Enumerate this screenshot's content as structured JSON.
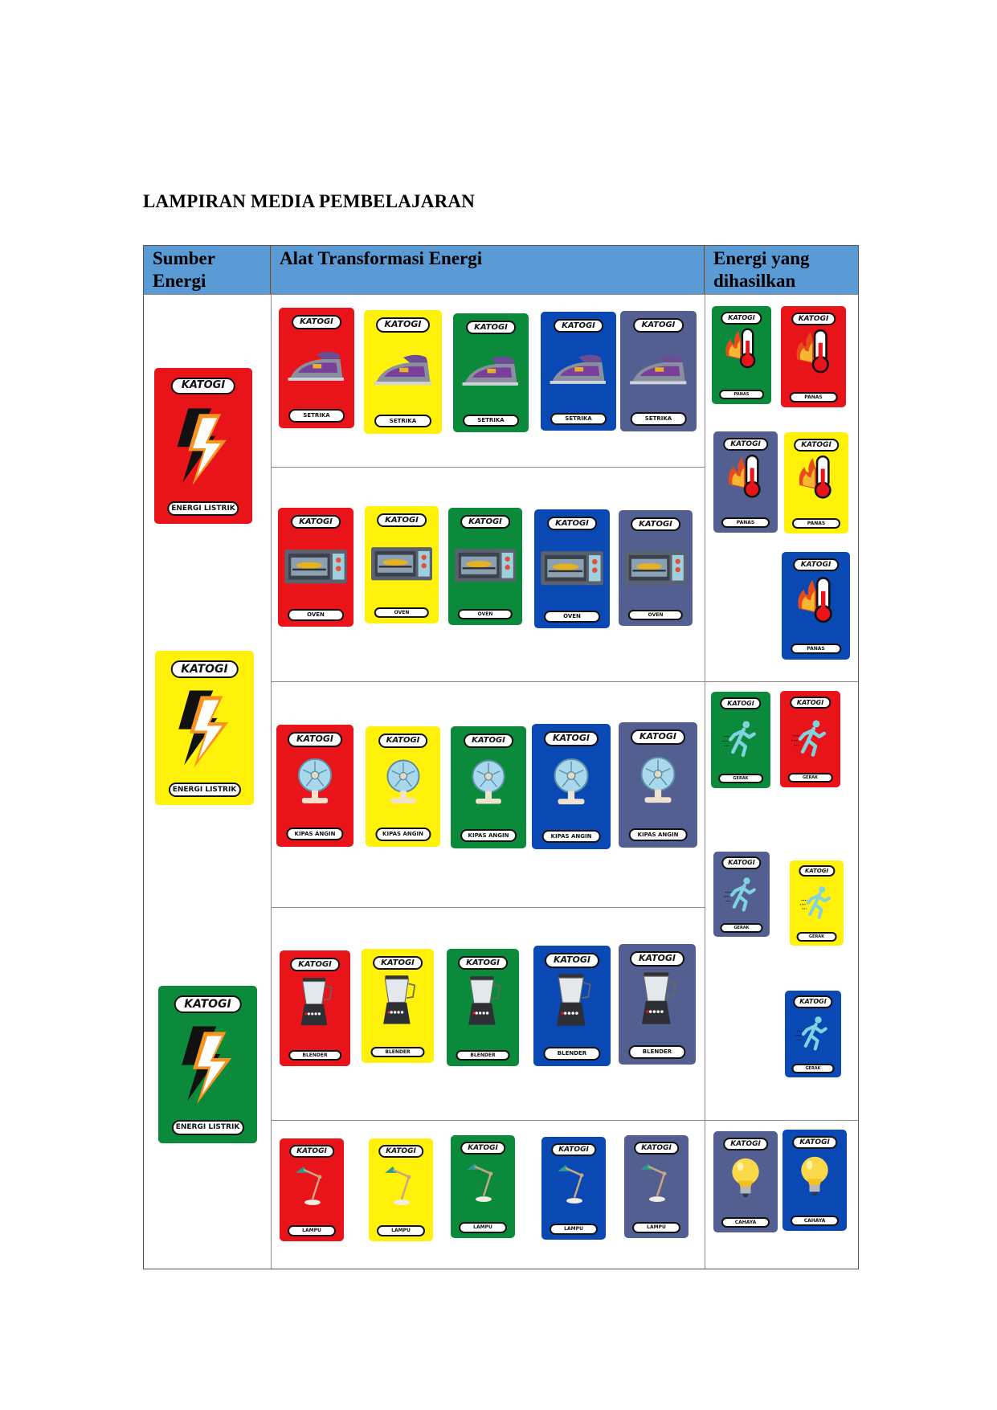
{
  "document": {
    "title": "LAMPIRAN MEDIA PEMBELAJARAN"
  },
  "table": {
    "headers": {
      "sumber": [
        "Sumber",
        "Energi"
      ],
      "alat": "Alat Transformasi Energi",
      "energi": [
        "Energi yang",
        "dihasilkan"
      ]
    }
  },
  "card_title": "KATOGI",
  "colors": {
    "red": "#e8141a",
    "yellow": "#fff10a",
    "green": "#0c8a3c",
    "blue": "#0a49b3",
    "slate": "#535f91",
    "header_blue": "#5b9bd5"
  },
  "sources": [
    {
      "color": "red",
      "label": "ENERGI LISTRIK",
      "icon": "lightning-icon"
    },
    {
      "color": "yellow",
      "label": "ENERGI LISTRIK",
      "icon": "lightning-icon"
    },
    {
      "color": "green",
      "label": "ENERGI LISTRIK",
      "icon": "lightning-icon"
    }
  ],
  "devices": [
    {
      "icon": "iron-icon",
      "labels": [
        "SETRIKA",
        "SETRIKA",
        "SETRIKA",
        "SETRIKA",
        "SETRIKA"
      ]
    },
    {
      "icon": "oven-icon",
      "labels": [
        "OVEN",
        "OVEN",
        "OVEN",
        "OVEN",
        "OVEN"
      ]
    },
    {
      "icon": "fan-icon",
      "labels": [
        "KIPAS ANGIN",
        "KIPAS ANGIN",
        "KIPAS ANGIN",
        "KIPAS ANGIN",
        "KIPAS ANGIN"
      ]
    },
    {
      "icon": "blender-icon",
      "labels": [
        "BLENDER",
        "BLENDER",
        "BLENDER",
        "BLENDER",
        "BLENDER"
      ]
    },
    {
      "icon": "lamp-icon",
      "labels": [
        "LAMPU",
        "LAMPU",
        "LAMPU",
        "LAMPU",
        "LAMPU"
      ]
    }
  ],
  "device_colors": [
    "red",
    "yellow",
    "green",
    "blue",
    "slate"
  ],
  "outputs": {
    "panas": {
      "icon": "thermometer-fire-icon",
      "label": "PANAS",
      "colors": [
        "green",
        "red",
        "slate",
        "yellow",
        "blue"
      ]
    },
    "gerak": {
      "icon": "running-person-icon",
      "label": "GERAK",
      "colors": [
        "green",
        "red",
        "slate",
        "yellow",
        "blue"
      ]
    },
    "cahaya": {
      "icon": "light-bulb-icon",
      "label": "CAHAYA",
      "colors": [
        "slate",
        "blue"
      ]
    }
  }
}
